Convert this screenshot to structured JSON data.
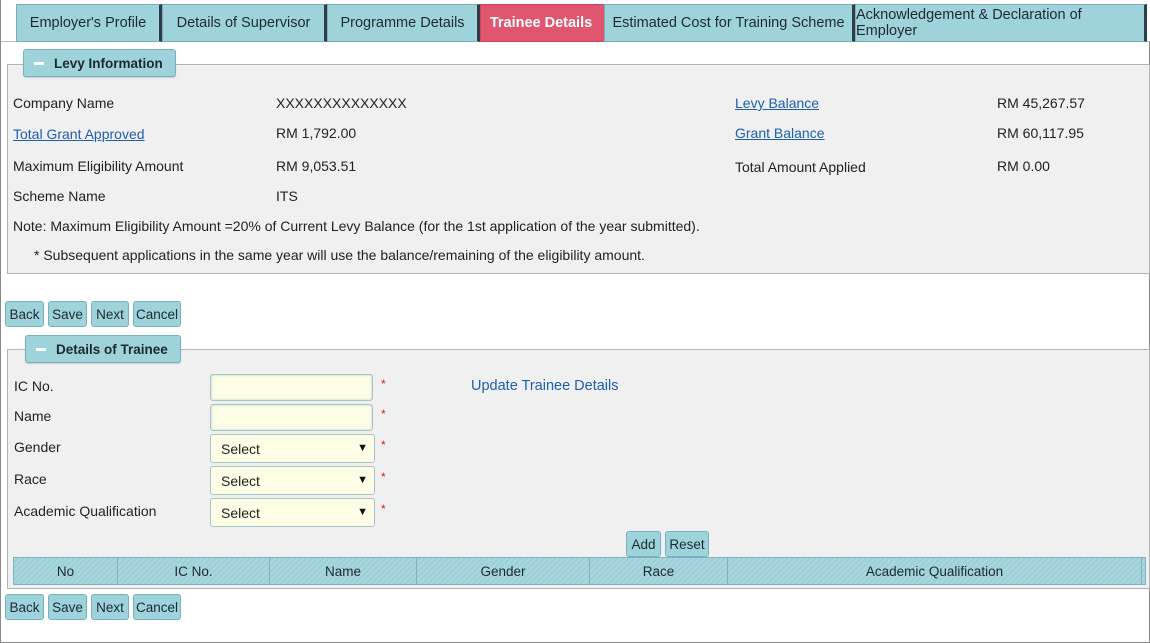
{
  "tabs": [
    {
      "label": "Employer's Profile"
    },
    {
      "label": "Details of Supervisor"
    },
    {
      "label": "Programme Details"
    },
    {
      "label": "Trainee Details"
    },
    {
      "label": "Estimated Cost for Training Scheme"
    },
    {
      "label": "Acknowledgement & Declaration of Employer"
    }
  ],
  "active_tab": "Trainee Details",
  "levy": {
    "legend": "Levy Information",
    "company_name_label": "Company Name",
    "company_name_value": "XXXXXXXXXXXXXX",
    "total_grant_label": "Total Grant Approved",
    "total_grant_value": "RM 1,792.00",
    "max_eligibility_label": "Maximum Eligibility Amount",
    "max_eligibility_value": "RM 9,053.51",
    "scheme_name_label": "Scheme Name",
    "scheme_name_value": "ITS",
    "levy_balance_label": "Levy Balance",
    "levy_balance_value": "RM 45,267.57",
    "grant_balance_label": "Grant Balance",
    "grant_balance_value": "RM 60,117.95",
    "total_applied_label": "Total Amount Applied",
    "total_applied_value": "RM 0.00",
    "note1": "Note: Maximum Eligibility Amount =20% of Current Levy Balance (for the 1st application of the year submitted).",
    "note2": "* Subsequent applications in the same year will use the balance/remaining of the eligibility amount."
  },
  "nav_buttons": {
    "back": "Back",
    "save": "Save",
    "next": "Next",
    "cancel": "Cancel"
  },
  "trainee": {
    "legend": "Details of Trainee",
    "ic_label": "IC No.",
    "ic_value": "",
    "name_label": "Name",
    "name_value": "",
    "gender_label": "Gender",
    "gender_selected": "Select",
    "race_label": "Race",
    "race_selected": "Select",
    "academic_label": "Academic Qualification",
    "academic_selected": "Select",
    "required_mark": "*",
    "update_link": "Update Trainee Details",
    "add_button": "Add",
    "reset_button": "Reset",
    "table_headers": [
      "No",
      "IC No.",
      "Name",
      "Gender",
      "Race",
      "Academic Qualification"
    ]
  },
  "colors": {
    "tab_bg": "#9fd3dc",
    "tab_active_bg": "#e0566f",
    "link": "#1d5fb0",
    "required": "#e02020",
    "input_bg": "#fdfde5"
  }
}
